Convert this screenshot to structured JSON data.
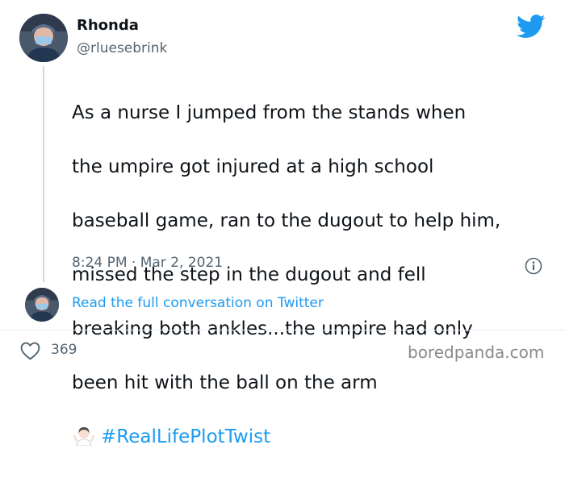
{
  "tweet": {
    "display_name": "Rhonda",
    "handle": "@rluesebrink",
    "lines": [
      "As a nurse I jumped from the stands when",
      "the umpire got injured at a high school",
      "baseball game, ran to the dugout to help him,",
      "missed the step in the dugout and fell",
      "breaking both ankles...the umpire had only",
      "been hit with the ball on the arm"
    ],
    "emoji": "woman-shrugging-emoji",
    "hashtag": "#RealLifePlotTwist",
    "timestamp": "8:24 PM · Mar 2, 2021",
    "read_link": "Read the full conversation on Twitter",
    "like_count": "369"
  },
  "watermark": "boredpanda.com",
  "colors": {
    "accent": "#1d9bf0",
    "text": "#0f1419",
    "muted": "#536471",
    "divider": "#e6ecf0"
  },
  "icons": {
    "logo": "twitter-bird-icon",
    "info": "info-icon",
    "like": "heart-icon"
  }
}
